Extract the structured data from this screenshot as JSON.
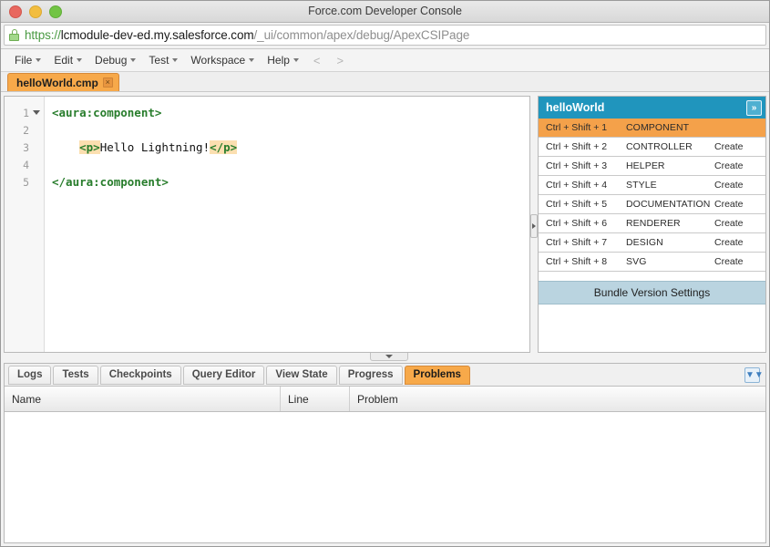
{
  "window": {
    "title": "Force.com Developer Console",
    "controls": [
      {
        "name": "close-button",
        "color": "#e8685f"
      },
      {
        "name": "minimize-button",
        "color": "#f2bd3f"
      },
      {
        "name": "zoom-button",
        "color": "#72c444"
      }
    ]
  },
  "urlbar": {
    "lock_icon": "lock-icon",
    "scheme": "https://",
    "host": "lcmodule-dev-ed.my.salesforce.com",
    "path": "/_ui/common/apex/debug/ApexCSIPage",
    "scheme_color": "#4a9a43",
    "host_color": "#1a1a1a",
    "path_color": "#8e8e8e"
  },
  "menubar": {
    "items": [
      {
        "label": "File",
        "has_caret": true
      },
      {
        "label": "Edit",
        "has_caret": true
      },
      {
        "label": "Debug",
        "has_caret": true
      },
      {
        "label": "Test",
        "has_caret": true
      },
      {
        "label": "Workspace",
        "has_caret": true
      },
      {
        "label": "Help",
        "has_caret": true
      }
    ],
    "nav_back": "<",
    "nav_forward": ">"
  },
  "editor_tabs": [
    {
      "label": "helloWorld.cmp",
      "close": "×",
      "active": true
    }
  ],
  "editor": {
    "lines": [
      {
        "number": "1",
        "fold": true,
        "segments": [
          {
            "text": "<aura:component>",
            "style": "tag"
          }
        ]
      },
      {
        "number": "2",
        "fold": false,
        "segments": []
      },
      {
        "number": "3",
        "fold": false,
        "segments": [
          {
            "text": "    ",
            "style": "plain"
          },
          {
            "text": "<p>",
            "style": "tag-hl"
          },
          {
            "text": "Hello Lightning!",
            "style": "text"
          },
          {
            "text": "</p>",
            "style": "tag-hl"
          }
        ]
      },
      {
        "number": "4",
        "fold": false,
        "segments": []
      },
      {
        "number": "5",
        "fold": false,
        "segments": [
          {
            "text": "</aura:component>",
            "style": "tag"
          }
        ]
      }
    ],
    "tag_color": "#287d2c",
    "highlight_color": "#fbdfb0"
  },
  "sidebar": {
    "header_title": "helloWorld",
    "header_color": "#2095bd",
    "expand_icon": "»",
    "active_row_color": "#f4a14a",
    "rows": [
      {
        "shortcut": "Ctrl + Shift + 1",
        "name": "COMPONENT",
        "action": "",
        "active": true
      },
      {
        "shortcut": "Ctrl + Shift + 2",
        "name": "CONTROLLER",
        "action": "Create",
        "active": false
      },
      {
        "shortcut": "Ctrl + Shift + 3",
        "name": "HELPER",
        "action": "Create",
        "active": false
      },
      {
        "shortcut": "Ctrl + Shift + 4",
        "name": "STYLE",
        "action": "Create",
        "active": false
      },
      {
        "shortcut": "Ctrl + Shift + 5",
        "name": "DOCUMENTATION",
        "action": "Create",
        "active": false
      },
      {
        "shortcut": "Ctrl + Shift + 6",
        "name": "RENDERER",
        "action": "Create",
        "active": false
      },
      {
        "shortcut": "Ctrl + Shift + 7",
        "name": "DESIGN",
        "action": "Create",
        "active": false
      },
      {
        "shortcut": "Ctrl + Shift + 8",
        "name": "SVG",
        "action": "Create",
        "active": false
      }
    ],
    "bundle_settings_label": "Bundle Version Settings",
    "bundle_settings_color": "#bad4e0"
  },
  "bottom_panel": {
    "tabs": [
      {
        "label": "Logs",
        "active": false
      },
      {
        "label": "Tests",
        "active": false
      },
      {
        "label": "Checkpoints",
        "active": false
      },
      {
        "label": "Query Editor",
        "active": false
      },
      {
        "label": "View State",
        "active": false
      },
      {
        "label": "Progress",
        "active": false
      },
      {
        "label": "Problems",
        "active": true
      }
    ],
    "active_tab_color": "#f7a94a",
    "collapse_icon": "»",
    "columns": [
      "Name",
      "Line",
      "Problem"
    ],
    "rows": []
  }
}
